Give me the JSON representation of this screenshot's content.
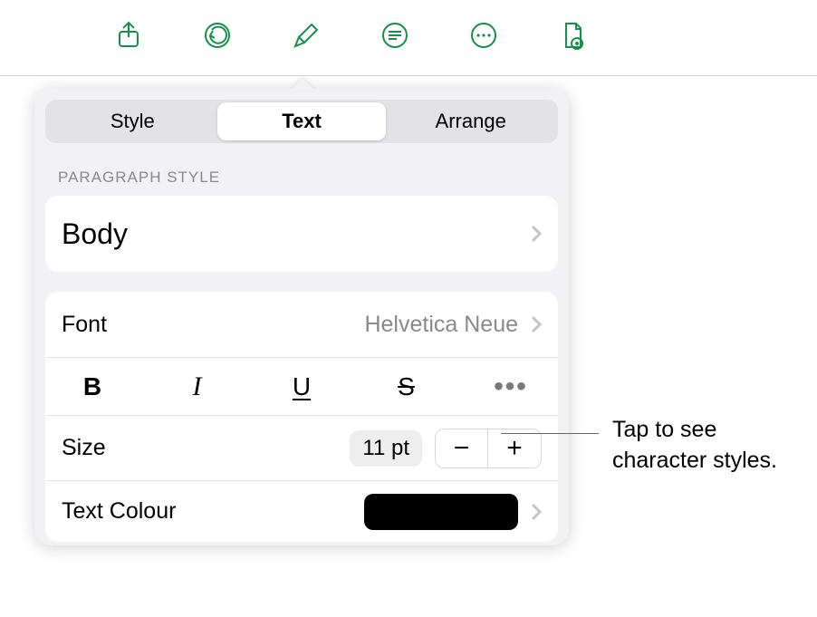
{
  "toolbar": {
    "share": "Share",
    "undo": "Undo",
    "format": "Format",
    "list": "Insert",
    "more": "More",
    "preview": "Document"
  },
  "tabs": {
    "style": "Style",
    "text": "Text",
    "arrange": "Arrange"
  },
  "section": {
    "paragraphStyleHeader": "Paragraph Style",
    "bodyStyleName": "Body"
  },
  "font": {
    "label": "Font",
    "value": "Helvetica Neue"
  },
  "formatButtons": {
    "bold": "B",
    "italic": "I",
    "underline": "U",
    "strike": "S",
    "more": "•••"
  },
  "size": {
    "label": "Size",
    "value": "11 pt",
    "minus": "−",
    "plus": "+"
  },
  "textColor": {
    "label": "Text Colour",
    "swatch": "#000000"
  },
  "callout": {
    "text": "Tap to see character styles."
  }
}
